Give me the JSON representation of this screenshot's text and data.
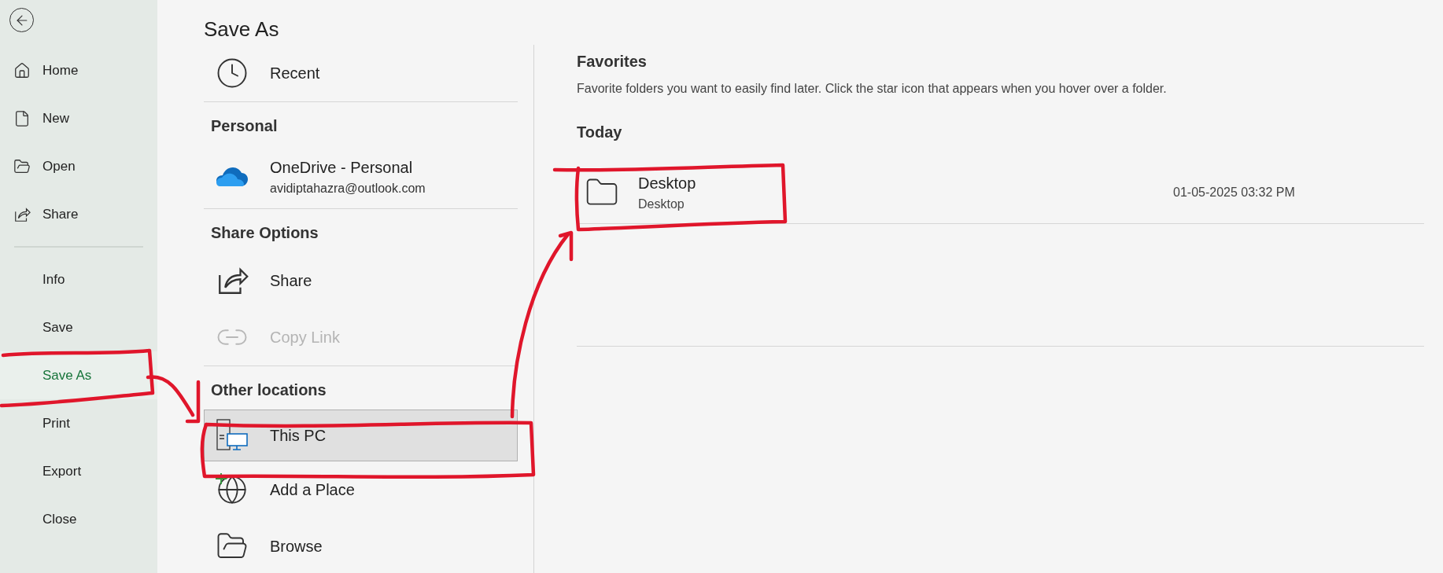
{
  "sidebar": {
    "top_items": [
      {
        "label": "Home",
        "selected": false
      },
      {
        "label": "New",
        "selected": false
      },
      {
        "label": "Open",
        "selected": false
      },
      {
        "label": "Share",
        "selected": false
      }
    ],
    "bottom_items": [
      {
        "label": "Info",
        "selected": false
      },
      {
        "label": "Save",
        "selected": false
      },
      {
        "label": "Save As",
        "selected": true
      },
      {
        "label": "Print",
        "selected": false
      },
      {
        "label": "Export",
        "selected": false
      },
      {
        "label": "Close",
        "selected": false
      }
    ]
  },
  "title": "Save As",
  "locations": [
    {
      "kind": "location",
      "label": "Recent",
      "selected": false,
      "disabled": false
    },
    {
      "kind": "header",
      "label": "Personal"
    },
    {
      "kind": "location",
      "label": "OneDrive - Personal",
      "sublabel": "avidiptahazra@outlook.com",
      "selected": false,
      "disabled": false
    },
    {
      "kind": "header",
      "label": "Share Options"
    },
    {
      "kind": "location",
      "label": "Share",
      "selected": false,
      "disabled": false
    },
    {
      "kind": "location",
      "label": "Copy Link",
      "selected": false,
      "disabled": true
    },
    {
      "kind": "header",
      "label": "Other locations"
    },
    {
      "kind": "location",
      "label": "This PC",
      "selected": true,
      "disabled": false
    },
    {
      "kind": "location",
      "label": "Add a Place",
      "selected": false,
      "disabled": false
    },
    {
      "kind": "location",
      "label": "Browse",
      "selected": false,
      "disabled": false
    }
  ],
  "favorites": {
    "heading": "Favorites",
    "description": "Favorite folders you want to easily find later. Click the star icon that appears when you hover over a folder."
  },
  "today": {
    "heading": "Today",
    "folders": [
      {
        "name": "Desktop",
        "path": "Desktop",
        "modified": "01-05-2025 03:32 PM"
      }
    ]
  }
}
